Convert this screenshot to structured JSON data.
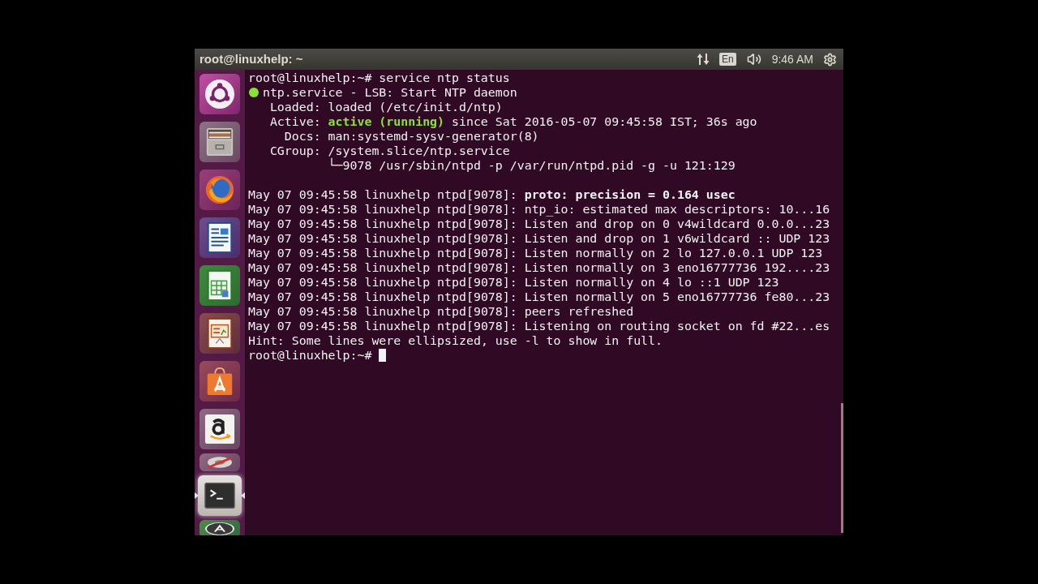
{
  "top_bar": {
    "title": "root@linuxhelp: ~",
    "keyboard_layout": "En",
    "clock": "9:46 AM"
  },
  "launcher": {
    "items": [
      {
        "kind": "dash",
        "focused": false,
        "folded": false
      },
      {
        "kind": "files",
        "focused": false,
        "folded": false
      },
      {
        "kind": "browser",
        "focused": false,
        "folded": false
      },
      {
        "kind": "writer",
        "focused": false,
        "folded": false
      },
      {
        "kind": "calc",
        "focused": false,
        "folded": false
      },
      {
        "kind": "impress",
        "focused": false,
        "folded": false
      },
      {
        "kind": "software",
        "focused": false,
        "folded": false
      },
      {
        "kind": "amazon",
        "focused": false,
        "folded": false
      },
      {
        "kind": "settings",
        "focused": false,
        "folded": true
      },
      {
        "kind": "terminal",
        "focused": true,
        "folded": false
      },
      {
        "kind": "updater",
        "focused": false,
        "folded": true
      }
    ]
  },
  "terminal": {
    "command": {
      "prompt": "root@linuxhelp:~#",
      "text": "service ntp status"
    },
    "unit": {
      "active": true,
      "title": "ntp.service - LSB: Start NTP daemon",
      "fields": [
        {
          "label": "Loaded:",
          "value": "loaded (/etc/init.d/ntp)"
        },
        {
          "label": "Active:",
          "value": "**active (running)** since Sat 2016-05-07 09:45:58 IST; 36s ago"
        },
        {
          "label": "Docs:",
          "value": "man:systemd-sysv-generator(8)"
        },
        {
          "label": "CGroup:",
          "value": "/system.slice/ntp.service",
          "children": [
            {
              "text": "└─9078 /usr/sbin/ntpd -p /var/run/ntpd.pid -g -u 121:129"
            }
          ]
        }
      ]
    },
    "journal": [
      "May 07 09:45:58 linuxhelp ntpd[9078]: **proto: precision = 0.164 usec**",
      "May 07 09:45:58 linuxhelp ntpd[9078]: ntp_io: estimated max descriptors: 10...16",
      "May 07 09:45:58 linuxhelp ntpd[9078]: Listen and drop on 0 v4wildcard 0.0.0...23",
      "May 07 09:45:58 linuxhelp ntpd[9078]: Listen and drop on 1 v6wildcard :: UDP 123",
      "May 07 09:45:58 linuxhelp ntpd[9078]: Listen normally on 2 lo 127.0.0.1 UDP 123",
      "May 07 09:45:58 linuxhelp ntpd[9078]: Listen normally on 3 eno16777736 192....23",
      "May 07 09:45:58 linuxhelp ntpd[9078]: Listen normally on 4 lo ::1 UDP 123",
      "May 07 09:45:58 linuxhelp ntpd[9078]: Listen normally on 5 eno16777736 fe80...23",
      "May 07 09:45:58 linuxhelp ntpd[9078]: peers refreshed",
      "May 07 09:45:58 linuxhelp ntpd[9078]: Listening on routing socket on fd #22...es"
    ],
    "hint": "Hint: Some lines were ellipsized, use -l to show in full.",
    "prompt": {
      "text": "root@linuxhelp:~#",
      "cursor": true
    }
  }
}
